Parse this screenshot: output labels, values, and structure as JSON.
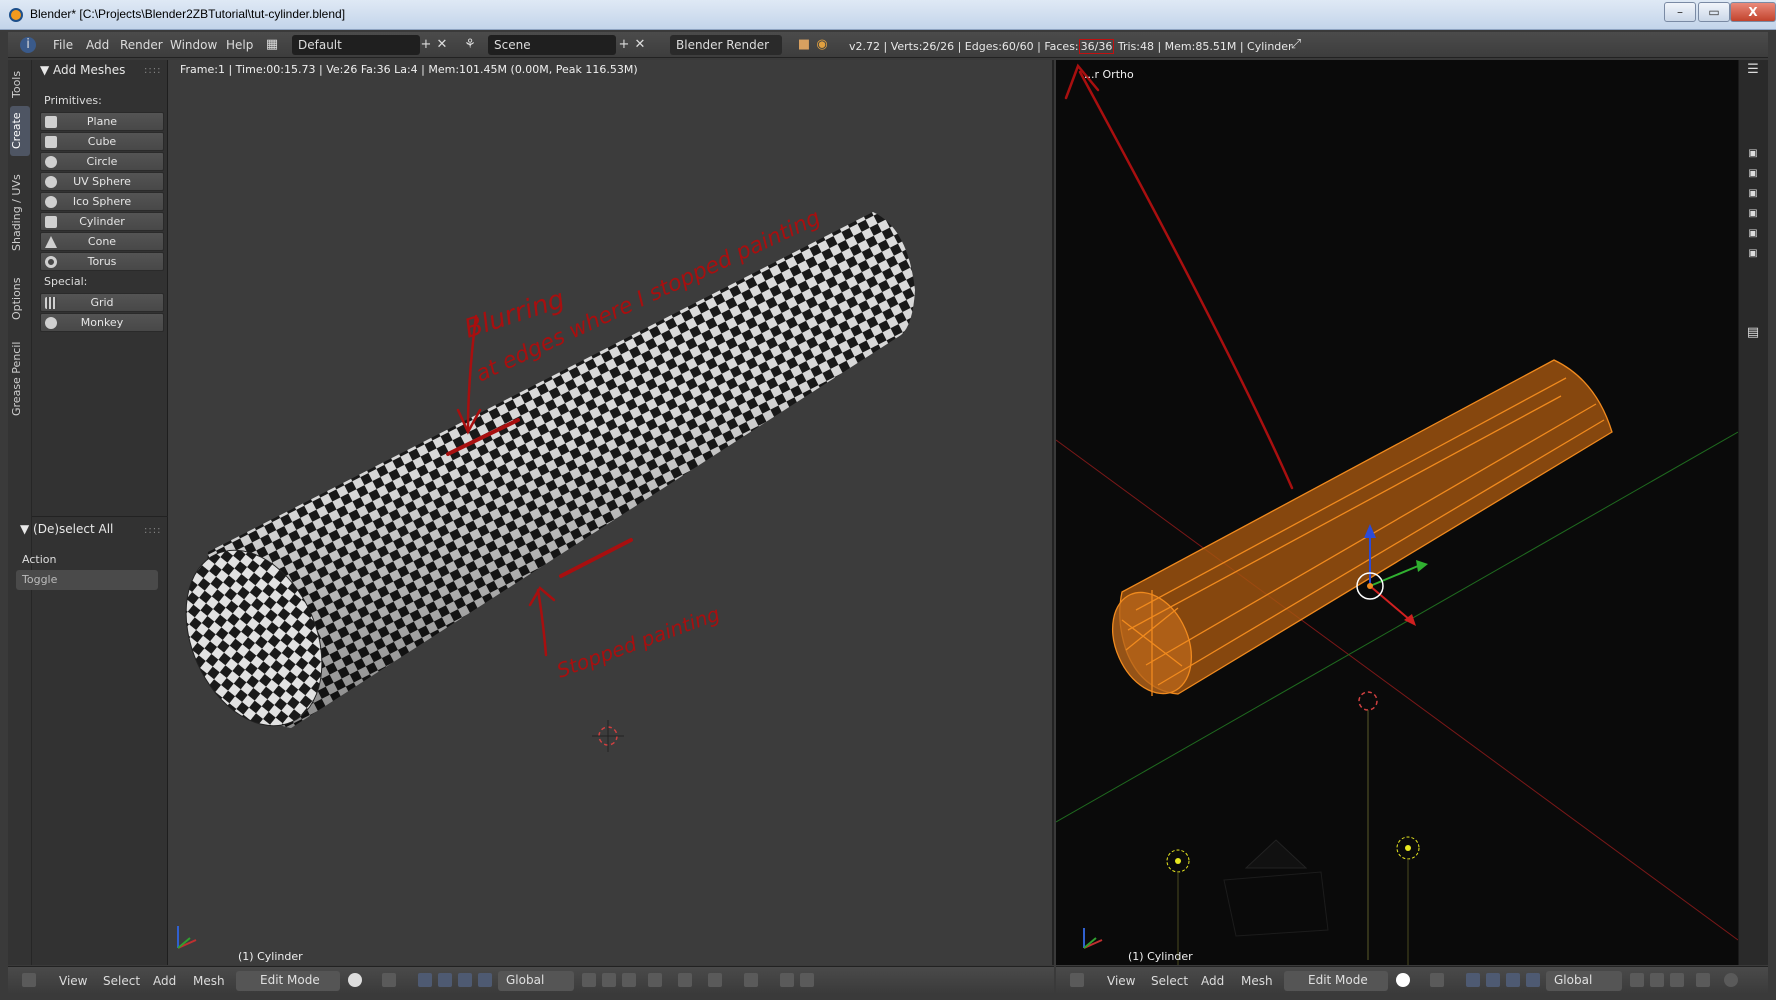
{
  "window": {
    "title": "Blender* [C:\\Projects\\Blender2ZBTutorial\\tut-cylinder.blend]",
    "min_label": "–",
    "max_label": "▭",
    "close_label": "X"
  },
  "header": {
    "menus": [
      "File",
      "Add",
      "Render",
      "Window",
      "Help"
    ],
    "layout": "Default",
    "scene": "Scene",
    "engine": "Blender Render",
    "stats_prefix": "v2.72 | Verts:26/26 | Edges:60/60 | Faces:",
    "faces": "36/36",
    "stats_suffix": " Tris:48 | Mem:85.51M | Cylinder"
  },
  "tabs": [
    "Tools",
    "Create",
    "Shading / UVs",
    "Options",
    "Grease Pencil"
  ],
  "add_meshes": {
    "title": "Add Meshes",
    "primitives_label": "Primitives:",
    "primitives": [
      "Plane",
      "Cube",
      "Circle",
      "UV Sphere",
      "Ico Sphere",
      "Cylinder",
      "Cone",
      "Torus"
    ],
    "special_label": "Special:",
    "special": [
      "Grid",
      "Monkey"
    ]
  },
  "operator": {
    "title": "(De)select All",
    "action_label": "Action",
    "action_value": "Toggle"
  },
  "left_viewport": {
    "info": "Frame:1 | Time:00:15.73 | Ve:26 Fa:36 La:4 | Mem:101.45M (0.00M, Peak 116.53M)",
    "object": "(1) Cylinder",
    "annotation_top_1": "Blurring",
    "annotation_top_2": "at edges where I stopped painting",
    "annotation_bottom": "Stopped painting",
    "annotation_color": "#a80f0f"
  },
  "right_viewport": {
    "info": "...r Ortho",
    "object": "(1) Cylinder"
  },
  "footer": {
    "items": [
      "View",
      "Select",
      "Add",
      "Mesh"
    ],
    "mode": "Edit Mode",
    "orientation": "Global"
  },
  "colors": {
    "selection_orange": "#f08a1e",
    "axis_red": "#b02020",
    "axis_green": "#2a8a2a"
  }
}
